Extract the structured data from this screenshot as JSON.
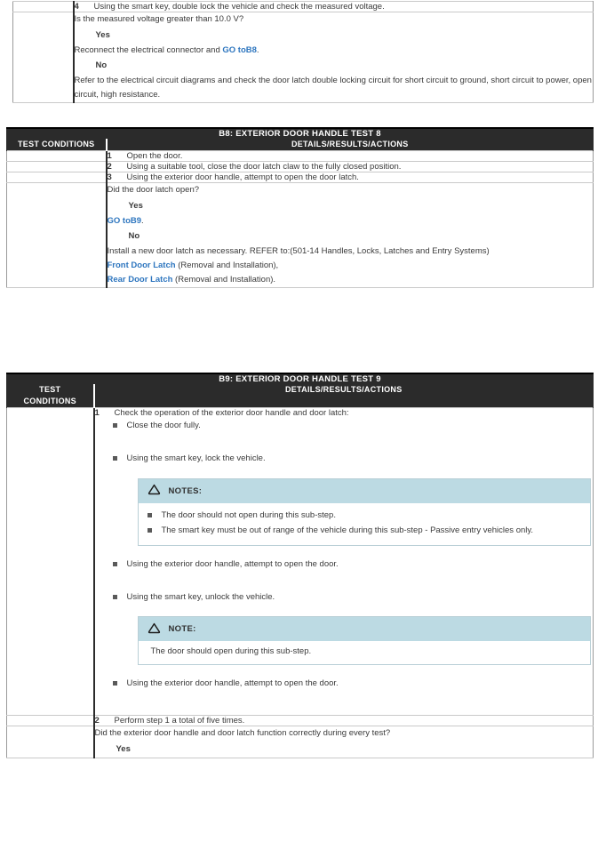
{
  "top_section": {
    "step": {
      "num": "4",
      "text": "Using the smart key, double lock the vehicle and check the measured voltage."
    },
    "decision": {
      "question": "Is the measured voltage greater than 10.0 V?",
      "yes_label": "Yes",
      "yes_text_before": "Reconnect the electrical connector and ",
      "yes_link": "GO toB8",
      "yes_text_after": ".",
      "no_label": "No",
      "no_text": "Refer to the electrical circuit diagrams and check the door latch double locking circuit for short circuit to ground, short circuit to power, open circuit, high resistance."
    }
  },
  "b8": {
    "banner": "B8: EXTERIOR DOOR HANDLE TEST 8",
    "col_test_conditions": "TEST CONDITIONS",
    "col_details": "DETAILS/RESULTS/ACTIONS",
    "steps": [
      {
        "num": "1",
        "text": "Open the door."
      },
      {
        "num": "2",
        "text": "Using a suitable tool, close the door latch claw to the fully closed position."
      },
      {
        "num": "3",
        "text": "Using the exterior door handle, attempt to open the door latch."
      }
    ],
    "decision": {
      "question": "Did the door latch open?",
      "yes_label": "Yes",
      "yes_link": "GO toB9",
      "yes_text_after": ".",
      "no_label": "No",
      "no_text": "Install a new door latch as necessary. REFER to:(501-14 Handles, Locks, Latches and Entry Systems)",
      "refs": [
        {
          "link": "Front Door Latch",
          "tail": " (Removal and Installation),"
        },
        {
          "link": "Rear Door Latch",
          "tail": " (Removal and Installation)."
        }
      ]
    }
  },
  "b9": {
    "banner": "B9: EXTERIOR DOOR HANDLE TEST 9",
    "col_test_conditions_line1": "TEST",
    "col_test_conditions_line2": "CONDITIONS",
    "col_details": "DETAILS/RESULTS/ACTIONS",
    "step1": {
      "num": "1",
      "text": "Check the operation of the exterior door handle and door latch:",
      "bullets": [
        "Close the door fully.",
        "Using the smart key, lock the vehicle.",
        "Using the exterior door handle, attempt to open the door.",
        "Using the smart key, unlock the vehicle.",
        "Using the exterior door handle, attempt to open the door."
      ]
    },
    "notes_box": {
      "icon": "warning-triangle-icon",
      "title": "NOTES:",
      "items": [
        "The door should not open during this sub-step.",
        "The smart key must be out of range of the vehicle during this sub-step - Passive entry vehicles only."
      ]
    },
    "note_box": {
      "icon": "warning-triangle-icon",
      "title": "NOTE:",
      "text": "The door should open during this sub-step."
    },
    "step2": {
      "num": "2",
      "text": "Perform step 1 a total of five times."
    },
    "decision": {
      "question": "Did the exterior door handle and door latch function correctly during every test?",
      "yes_label": "Yes"
    }
  },
  "colors": {
    "banner_bg": "#2b2b2b",
    "link_blue": "#2e76bf",
    "note_header_bg": "#bcdae3",
    "note_border": "#b9cfd6",
    "rule_gray": "#c9c9c9"
  }
}
